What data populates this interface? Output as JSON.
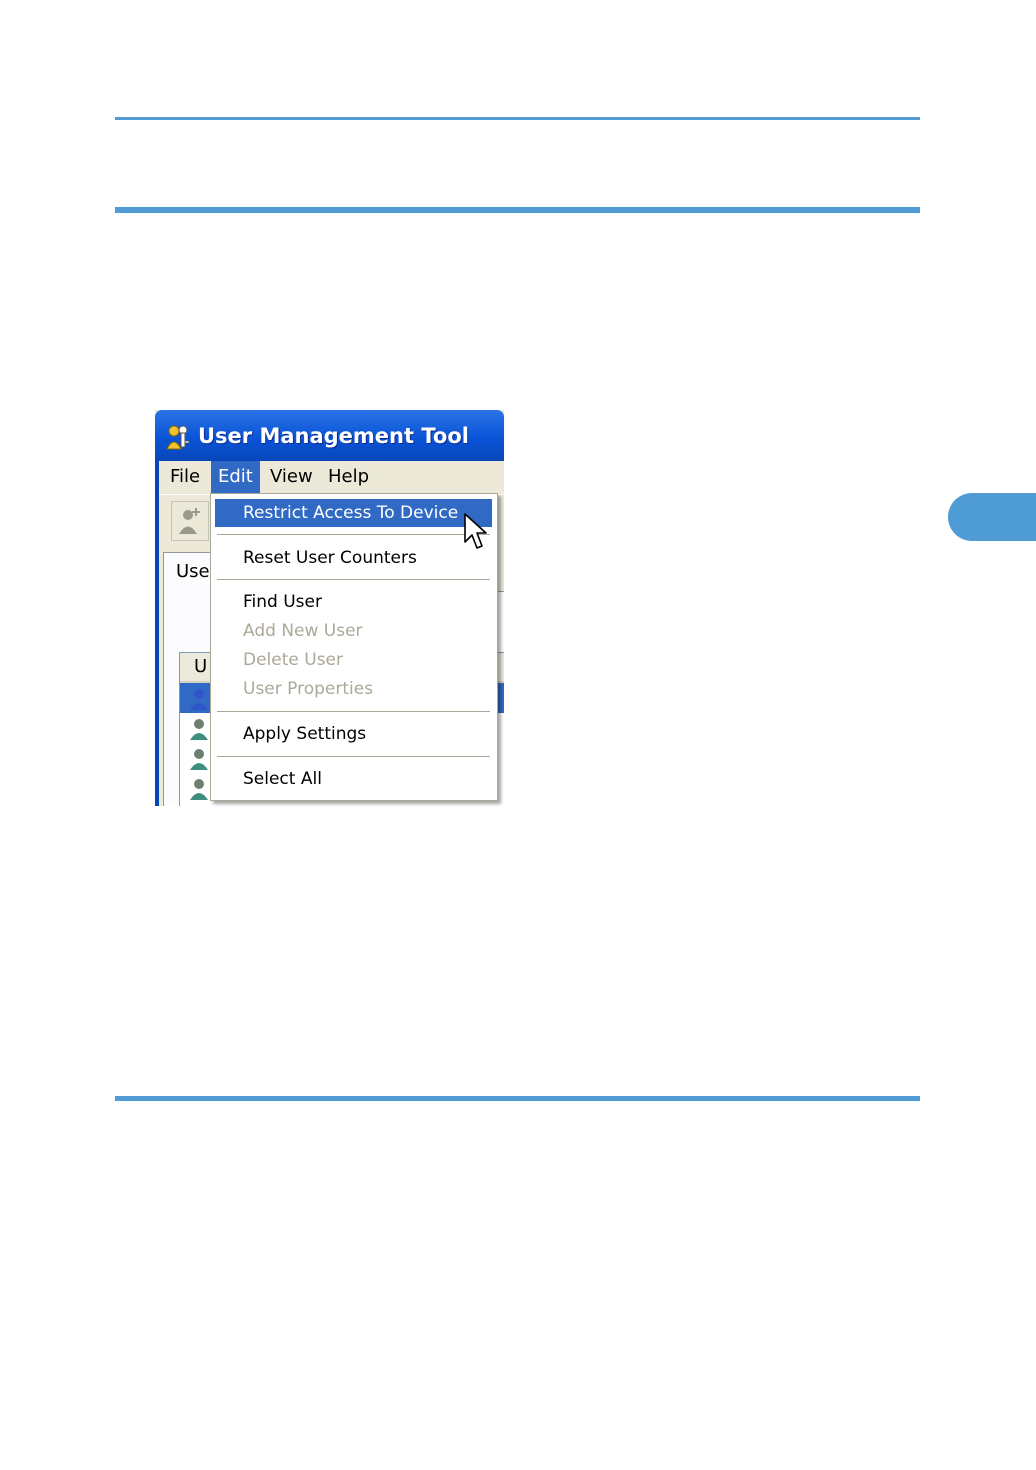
{
  "window": {
    "title": "User Management Tool"
  },
  "menubar": {
    "items": [
      {
        "label": "File"
      },
      {
        "label": "Edit"
      },
      {
        "label": "View"
      },
      {
        "label": "Help"
      }
    ],
    "active": "Edit"
  },
  "tab": {
    "label": "Use"
  },
  "list": {
    "header": "U"
  },
  "edit_menu": {
    "items": [
      {
        "label": "Restrict Access To Device",
        "state": "highlighted"
      },
      {
        "label": "Reset User Counters",
        "state": "enabled"
      },
      {
        "label": "Find User",
        "state": "enabled"
      },
      {
        "label": "Add New User",
        "state": "disabled"
      },
      {
        "label": "Delete User",
        "state": "disabled"
      },
      {
        "label": "User Properties",
        "state": "disabled"
      },
      {
        "label": "Apply Settings",
        "state": "enabled"
      },
      {
        "label": "Select All",
        "state": "enabled"
      }
    ]
  },
  "colors": {
    "accent_rule": "#4f9bd5",
    "menu_highlight": "#316ac5",
    "titlebar": "#0a54d8",
    "disabled_text": "#aca899"
  },
  "icons": [
    "app-icon",
    "add-user-icon",
    "user-icon",
    "mouse-cursor-icon",
    "chapter-tab"
  ]
}
